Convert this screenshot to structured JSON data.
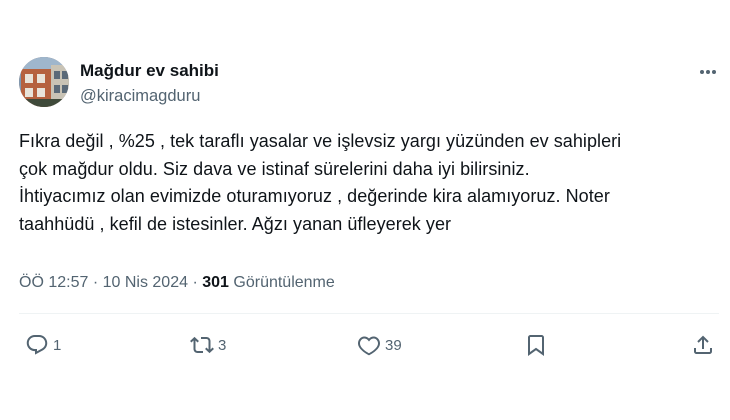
{
  "author": {
    "display_name": "Mağdur ev sahibi",
    "handle": "@kiracimagduru"
  },
  "tweet": {
    "lines": [
      "Fıkra değil , %25 , tek taraflı yasalar ve işlevsiz yargı yüzünden ev sahipleri",
      "çok mağdur oldu. Siz dava ve istinaf sürelerini daha iyi bilirsiniz.",
      "İhtiyacımız olan evimizde oturamıyoruz , değerinde kira alamıyoruz. Noter",
      "taahhüdü , kefil de istesinler. Ağzı yanan üfleyerek yer"
    ],
    "time": "ÖÖ 12:57",
    "separator": "·",
    "date": "10 Nis 2024",
    "views_count": "301",
    "views_label": "Görüntülenme"
  },
  "actions": {
    "reply_count": "1",
    "retweet_count": "3",
    "like_count": "39"
  },
  "icons": {
    "more": "more-icon",
    "reply": "reply-icon",
    "retweet": "retweet-icon",
    "like": "heart-icon",
    "bookmark": "bookmark-icon",
    "share": "share-icon"
  },
  "colors": {
    "text_primary": "#0f1419",
    "text_secondary": "#536471",
    "divider": "#eff3f4"
  }
}
